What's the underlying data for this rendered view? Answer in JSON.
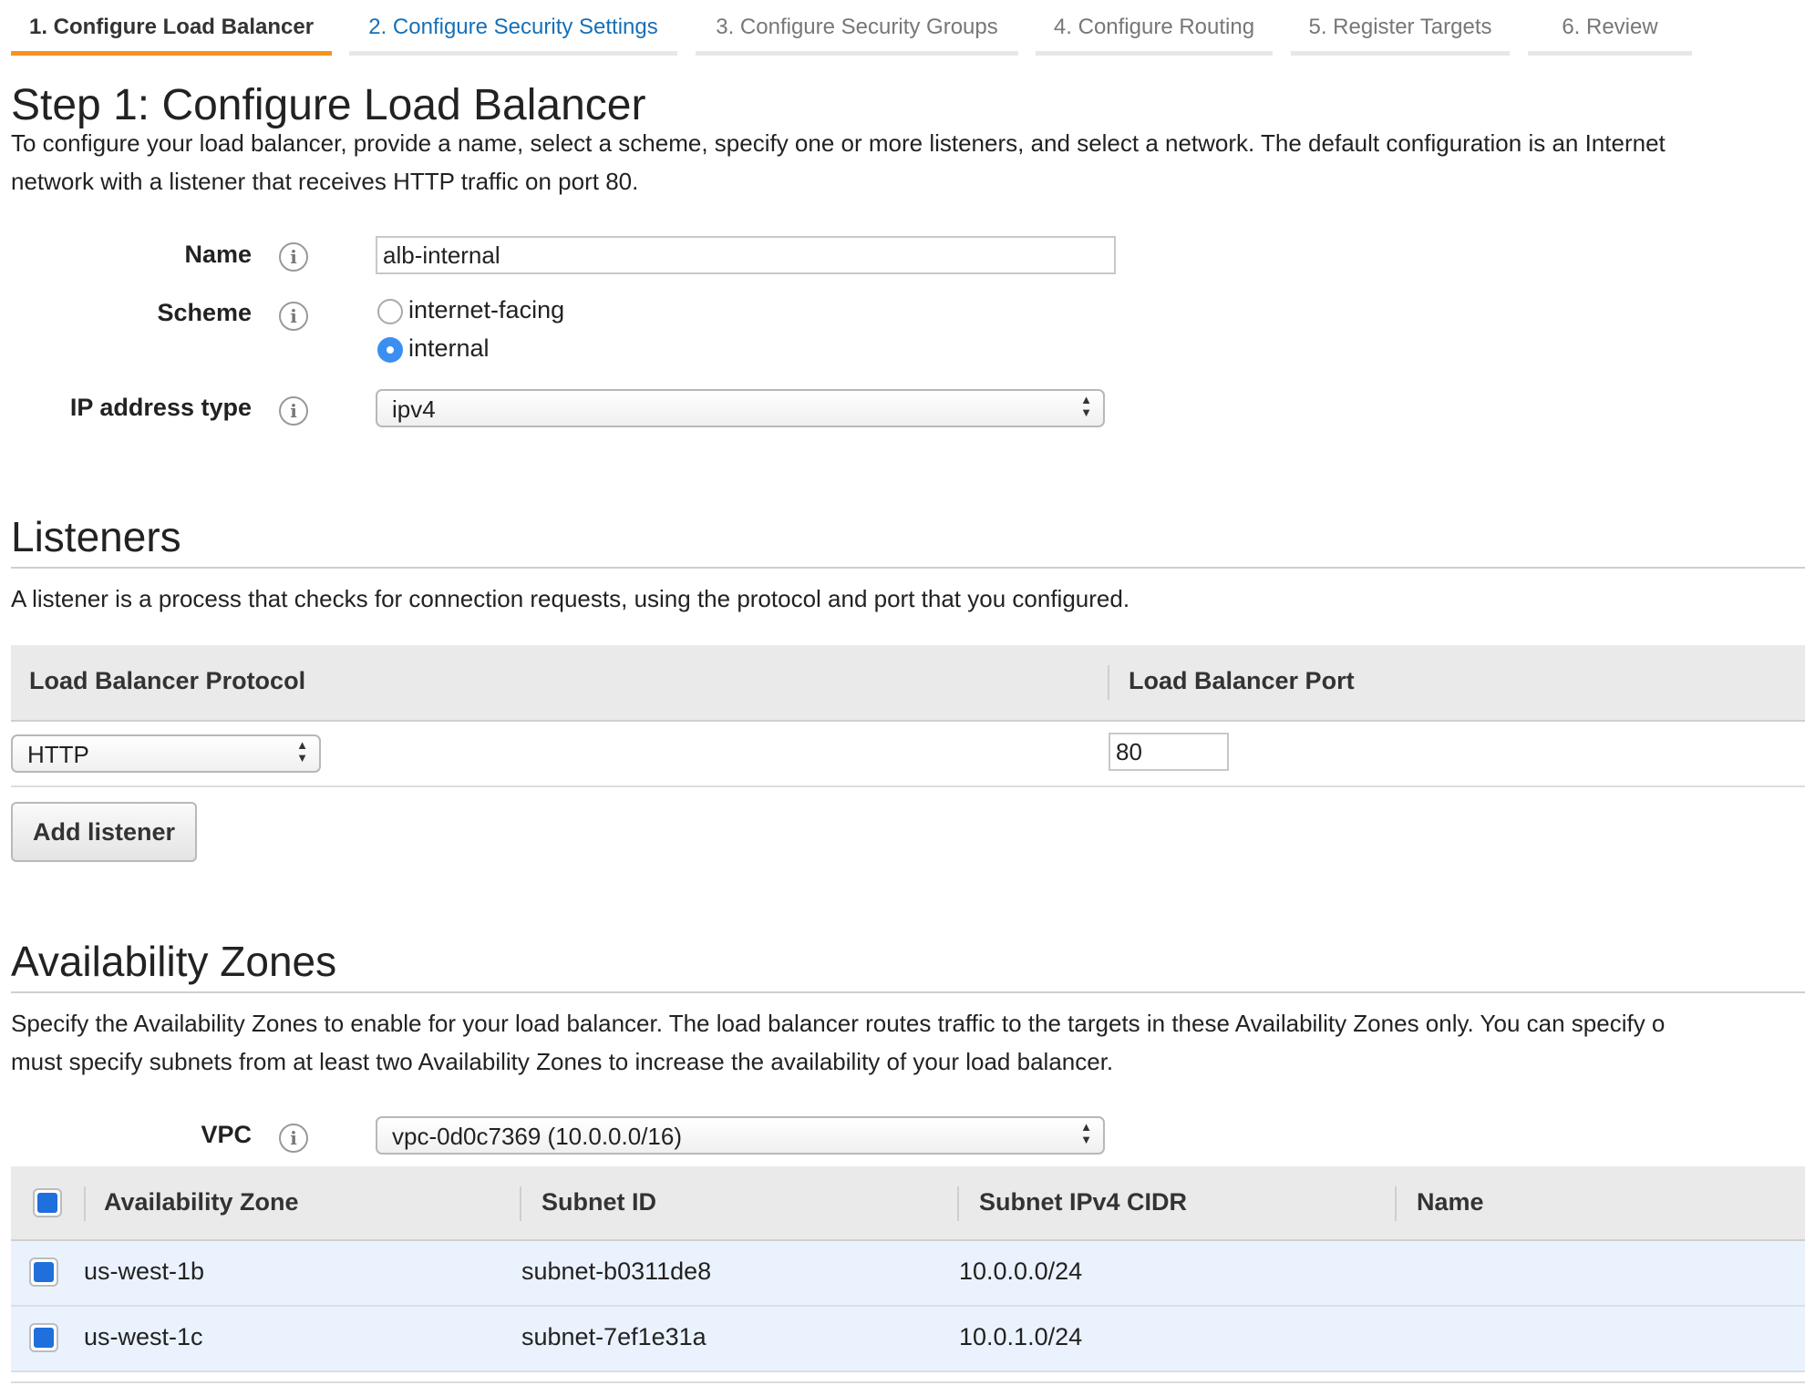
{
  "wizard": {
    "tabs": [
      {
        "label": "1. Configure Load Balancer"
      },
      {
        "label": "2. Configure Security Settings"
      },
      {
        "label": "3. Configure Security Groups"
      },
      {
        "label": "4. Configure Routing"
      },
      {
        "label": "5. Register Targets"
      },
      {
        "label": "6. Review"
      }
    ]
  },
  "page": {
    "title": "Step 1: Configure Load Balancer",
    "intro_line1": "To configure your load balancer, provide a name, select a scheme, specify one or more listeners, and select a network. The default configuration is an Internet",
    "intro_line2": "network with a listener that receives HTTP traffic on port 80."
  },
  "form": {
    "name_label": "Name",
    "name_value": "alb-internal",
    "scheme_label": "Scheme",
    "scheme_options": [
      "internet-facing",
      "internal"
    ],
    "scheme_selected": "internal",
    "ip_label": "IP address type",
    "ip_value": "ipv4"
  },
  "listeners": {
    "title": "Listeners",
    "description": "A listener is a process that checks for connection requests, using the protocol and port that you configured.",
    "col_protocol": "Load Balancer Protocol",
    "col_port": "Load Balancer Port",
    "protocol_value": "HTTP",
    "port_value": "80",
    "add_button": "Add listener"
  },
  "availability": {
    "title": "Availability Zones",
    "desc_line1": "Specify the Availability Zones to enable for your load balancer. The load balancer routes traffic to the targets in these Availability Zones only. You can specify o",
    "desc_line2": "must specify subnets from at least two Availability Zones to increase the availability of your load balancer.",
    "vpc_label": "VPC",
    "vpc_value": "vpc-0d0c7369 (10.0.0.0/16)",
    "columns": [
      "Availability Zone",
      "Subnet ID",
      "Subnet IPv4 CIDR",
      "Name"
    ],
    "rows": [
      {
        "zone": "us-west-1b",
        "subnet": "subnet-b0311de8",
        "cidr": "10.0.0.0/24",
        "name": ""
      },
      {
        "zone": "us-west-1c",
        "subnet": "subnet-7ef1e31a",
        "cidr": "10.0.1.0/24",
        "name": ""
      }
    ]
  },
  "icons": {
    "info": "info-circle-icon",
    "select": "updown-arrows-icon",
    "check": "checkbox-checked-icon"
  },
  "colors": {
    "active_tab": "#f7931e",
    "link": "#1570b8",
    "radio_selected": "#3b8ff0",
    "checkbox": "#1f6fdc",
    "row_selected": "#eaf3fd"
  }
}
